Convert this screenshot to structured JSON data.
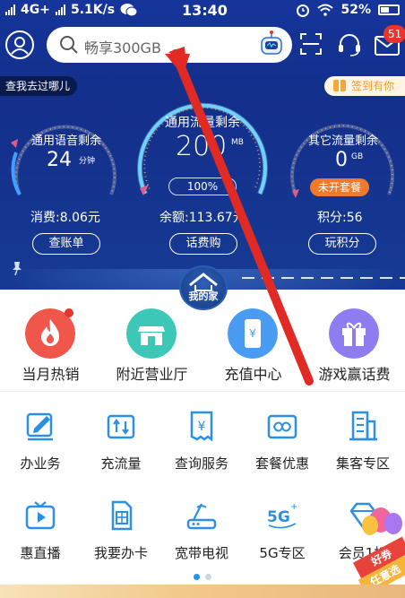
{
  "status_bar": {
    "network": "4G+",
    "speed": "5.1K/s",
    "time": "13:40",
    "battery": "52%"
  },
  "header": {
    "search_placeholder": "畅享300GB",
    "message_badge": "51"
  },
  "pills": {
    "left": "查我去过哪儿",
    "right": "签到有你"
  },
  "gauges": [
    {
      "title": "通用语音剩余",
      "value": "24",
      "unit": "分钟",
      "chip": ""
    },
    {
      "title": "通用流量剩余",
      "value": "200",
      "unit": "MB",
      "chip": "100%"
    },
    {
      "title": "其它流量剩余",
      "value": "0",
      "unit": "GB",
      "chip": "未开套餐"
    }
  ],
  "stats": [
    {
      "text": "消费:8.06元",
      "button": "查账单"
    },
    {
      "text": "余额:113.67元",
      "button": "话费购"
    },
    {
      "text": "积分:56",
      "button": "玩积分"
    }
  ],
  "home_label": "我的家",
  "features": [
    {
      "label": "当月热销",
      "color": "#f0574a"
    },
    {
      "label": "附近营业厅",
      "color": "#3dc7b7"
    },
    {
      "label": "充值中心",
      "color": "#4a9bf2"
    },
    {
      "label": "游戏赢话费",
      "color": "#8d7df0"
    }
  ],
  "services": [
    {
      "label": "办业务"
    },
    {
      "label": "充流量"
    },
    {
      "label": "查询服务"
    },
    {
      "label": "套餐优惠"
    },
    {
      "label": "集客专区"
    },
    {
      "label": "惠直播"
    },
    {
      "label": "我要办卡"
    },
    {
      "label": "宽带电视"
    },
    {
      "label": "5G专区"
    },
    {
      "label": "会员1折"
    }
  ],
  "promo": {
    "line1": "好券",
    "line2": "任意选"
  },
  "colors": {
    "hero": "#132f8b",
    "accent_blue": "#2b8fe6",
    "badge_red": "#e8342c",
    "chip_orange": "#f07a2b"
  }
}
